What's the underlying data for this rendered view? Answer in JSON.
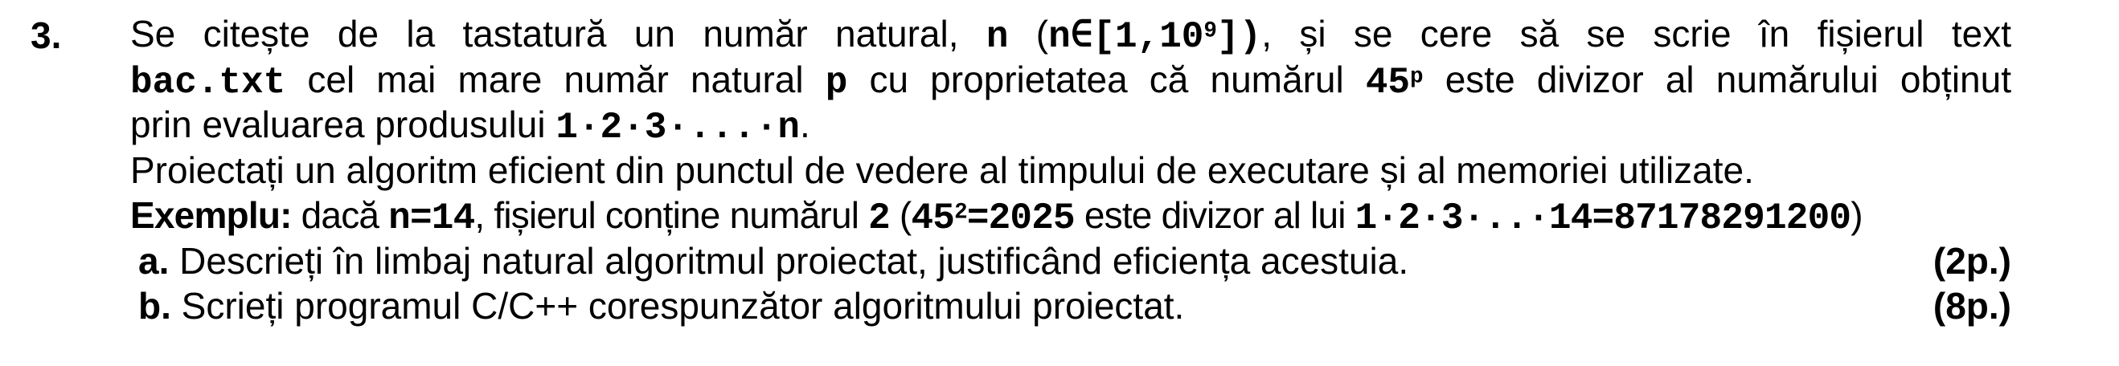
{
  "problem": {
    "number": "3.",
    "l1": {
      "t1": "Se citește de la tastatură un număr natural, ",
      "n": "n",
      "t2": " (",
      "domain": "n∈[1,10",
      "exp": "9",
      "domain_end": "])",
      "t3": ", și se cere să se scrie în fișierul text"
    },
    "l2": {
      "file": "bac.txt",
      "t1": " cel mai mare număr natural ",
      "p": "p",
      "t2": " cu proprietatea că numărul ",
      "base": "45",
      "exp": "p",
      "t3": " este divizor al numărului obținut"
    },
    "l3": {
      "t1": "prin evaluarea produsului ",
      "product": "1·2·3·...·n",
      "t2": "."
    },
    "l4": "Proiectați un algoritm eficient din punctul de vedere al timpului de executare și al memoriei utilizate.",
    "example": {
      "label": "Exemplu:",
      "t1": " dacă ",
      "n_eq": "n=14",
      "t2": ", fișierul conține numărul ",
      "value": "2",
      "t3": " (",
      "base": "45",
      "exp": "2",
      "pow_val": "=2025",
      "t4": " este divizor al lui ",
      "product": "1·2·3·..·14=87178291200",
      "t5": ")"
    },
    "items": [
      {
        "letter": "a.",
        "text": " Descrieți în limbaj natural algoritmul proiectat, justificând eficiența acestuia.",
        "points": "(2p.)"
      },
      {
        "letter": "b.",
        "text": " Scrieți programul C/C++ corespunzător algoritmului proiectat.",
        "points": "(8p.)"
      }
    ]
  }
}
